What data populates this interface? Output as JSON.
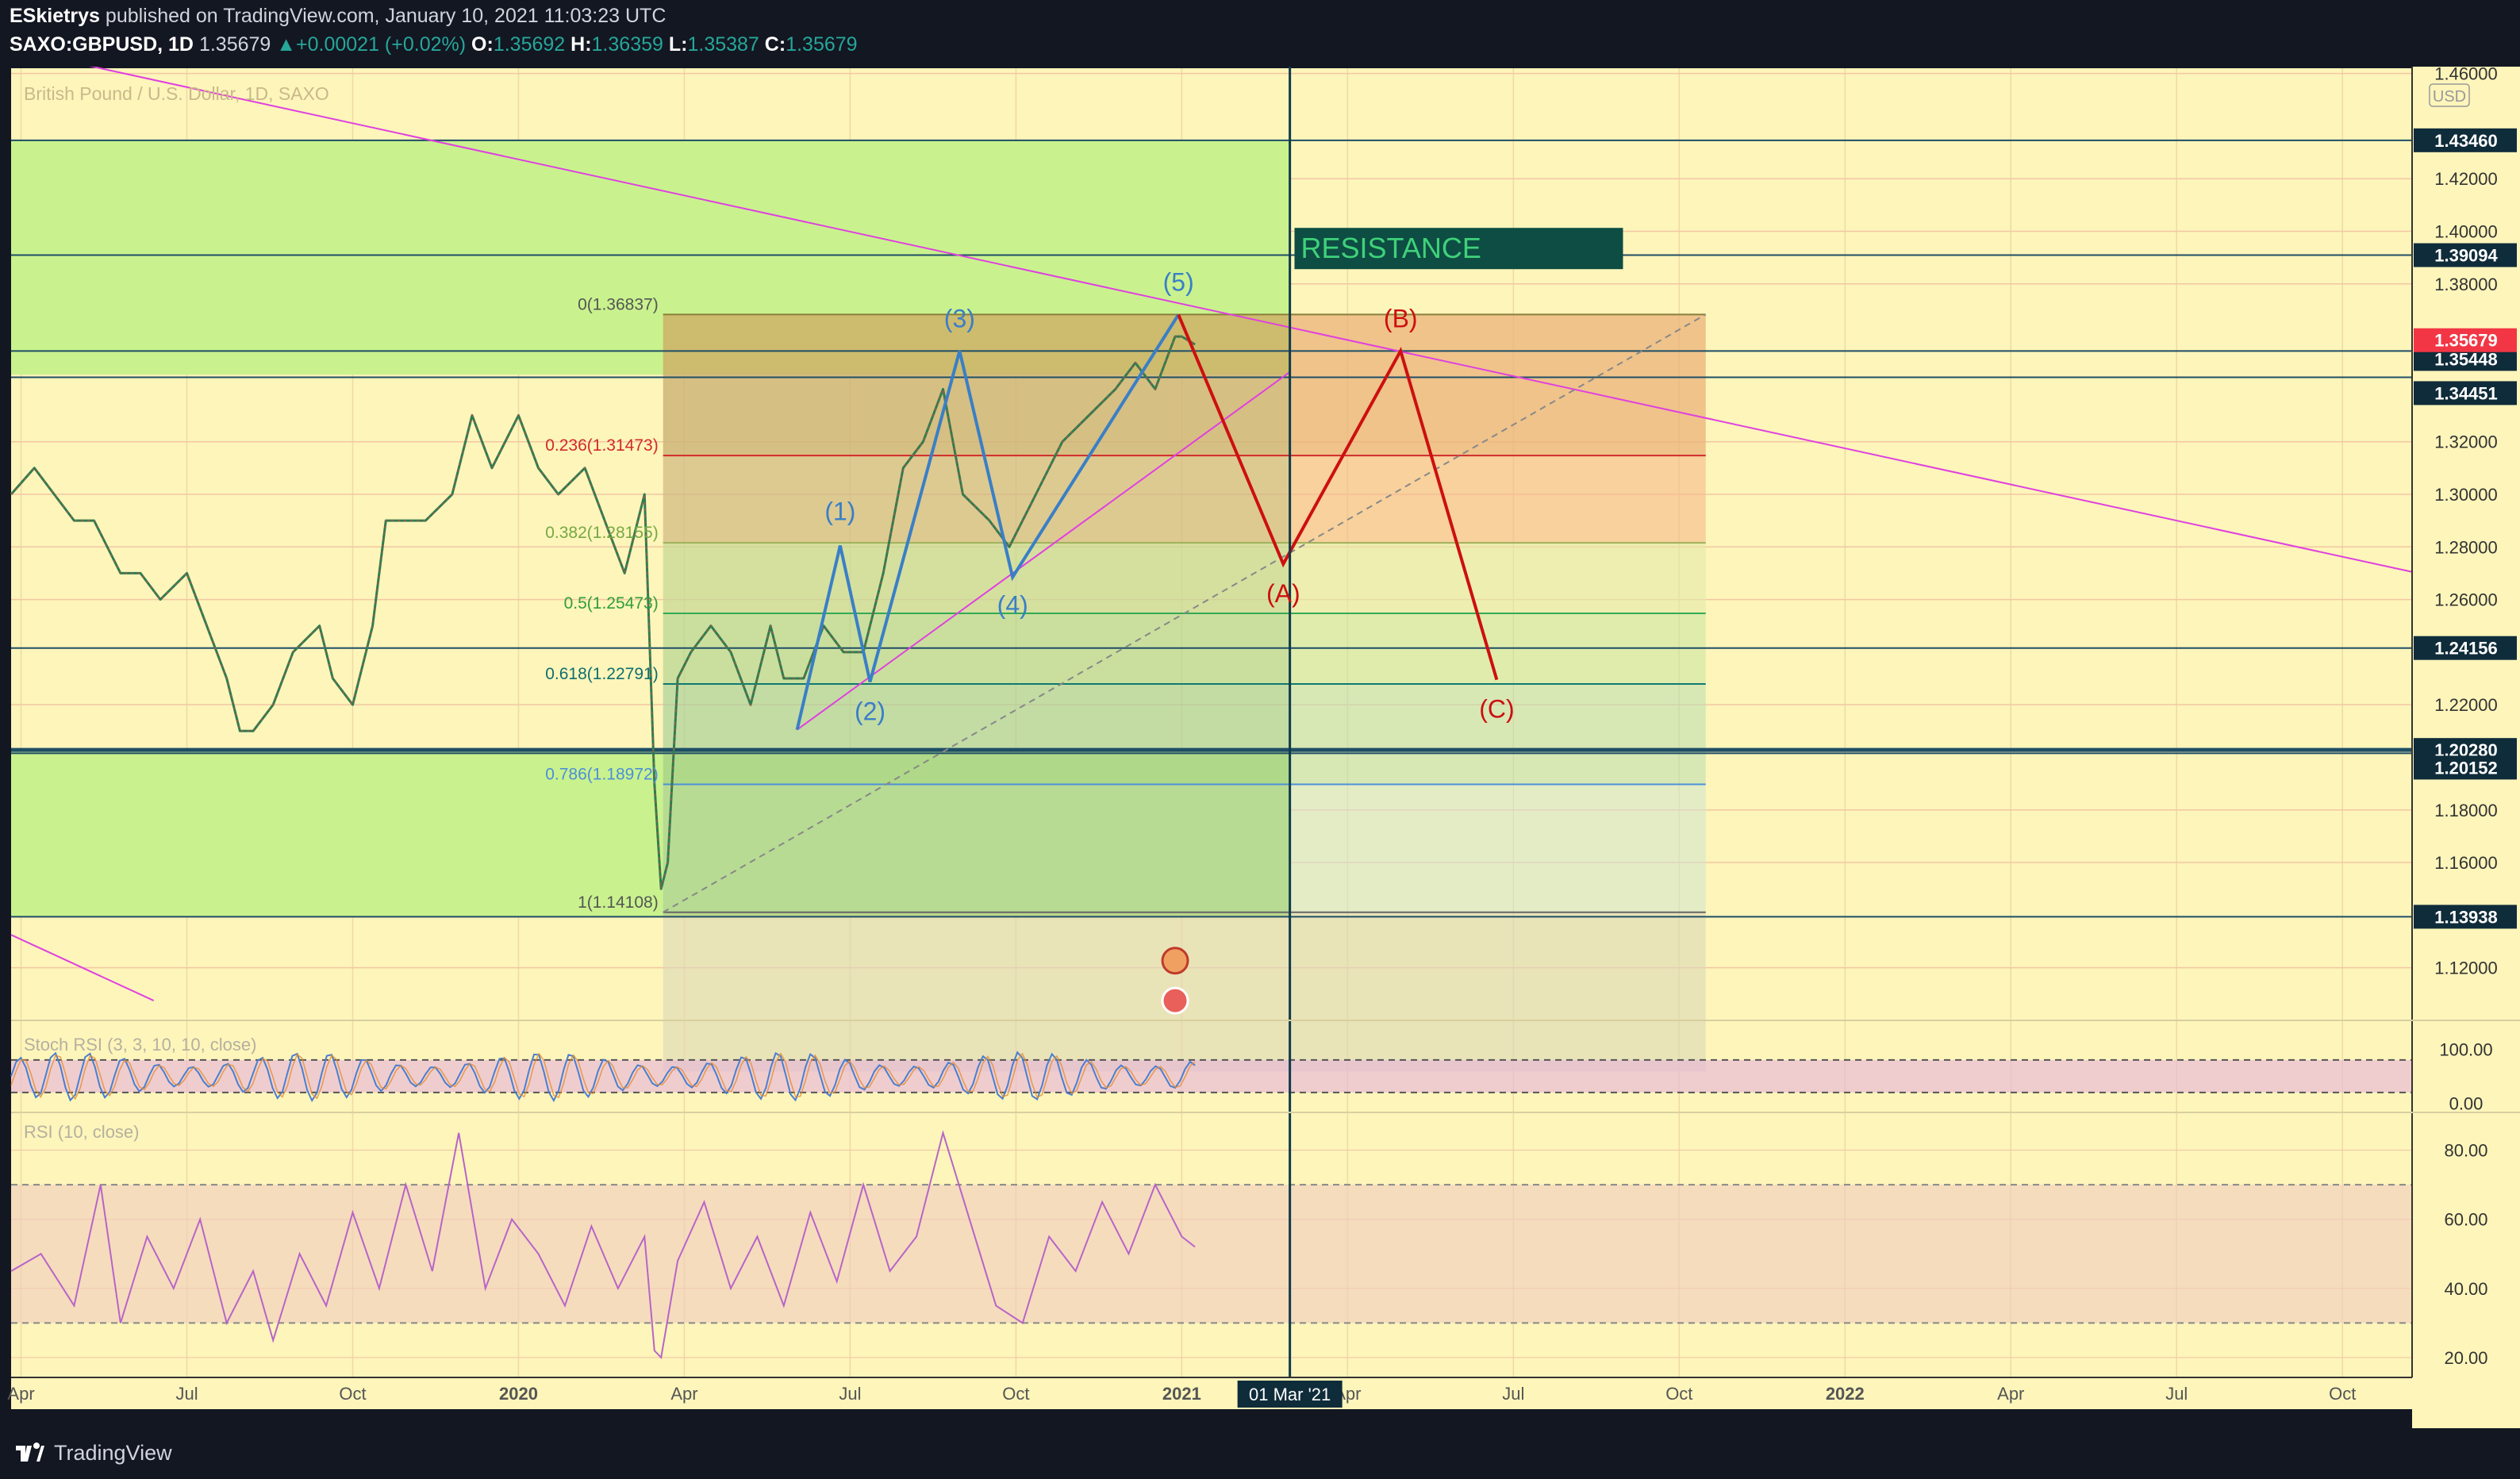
{
  "header": {
    "publisher": "ESkietrys",
    "published_text": " published on TradingView.com, January 10, 2021 11:03:23 UTC",
    "symbol": "SAXO:GBPUSD, 1D",
    "last": "1.35679",
    "change": "+0.00021 (+0.02%)",
    "o_label": "O:",
    "o": "1.35692",
    "h_label": "H:",
    "h": "1.36359",
    "l_label": "L:",
    "l": "1.35387",
    "c_label": "C:",
    "c": "1.35679"
  },
  "footer": {
    "brand": "TradingView"
  },
  "colors": {
    "background": "#fdf5ba",
    "green_zone": "#c9f28e",
    "resistance_box": "#0d4d43",
    "resistance_text": "#3fd17a",
    "wave_blue": "#3a7fc6",
    "wave_red": "#cc1010",
    "trend_magenta": "#e040e0",
    "level_line": "#1f4e66",
    "price_label_bg": "#0f2c3a",
    "current_price_bg": "#f23645"
  },
  "chart_data": [
    {
      "type": "line",
      "title": "British Pound / U.S. Dollar, 1D, SAXO",
      "currency_label": "USD",
      "x_ticks": [
        "Apr",
        "Jul",
        "Oct",
        "2020",
        "Apr",
        "Jul",
        "Oct",
        "2021",
        "Apr",
        "Jul",
        "Oct",
        "2022",
        "Apr",
        "Jul",
        "Oct"
      ],
      "x_tick_years": [
        2019.25,
        2019.5,
        2019.75,
        2020.0,
        2020.25,
        2020.5,
        2020.75,
        2021.0,
        2021.25,
        2021.5,
        2021.75,
        2022.0,
        2022.25,
        2022.5,
        2022.75
      ],
      "xlim": [
        2019.235,
        2022.855
      ],
      "ylim": [
        1.103,
        1.462
      ],
      "y_ticks": [
        1.46,
        1.42,
        1.4,
        1.38,
        1.32,
        1.3,
        1.28,
        1.26,
        1.22,
        1.18,
        1.16,
        1.12
      ],
      "y_tick_labels": [
        "1.46000",
        "1.42000",
        "1.40000",
        "1.38000",
        "1.32000",
        "1.30000",
        "1.28000",
        "1.26000",
        "1.22000",
        "1.18000",
        "1.16000",
        "1.12000"
      ],
      "price_series": {
        "x": [
          2019.235,
          2019.27,
          2019.3,
          2019.33,
          2019.36,
          2019.4,
          2019.43,
          2019.46,
          2019.5,
          2019.53,
          2019.56,
          2019.58,
          2019.6,
          2019.63,
          2019.66,
          2019.7,
          2019.72,
          2019.75,
          2019.78,
          2019.8,
          2019.83,
          2019.86,
          2019.9,
          2019.93,
          2019.96,
          2020.0,
          2020.03,
          2020.06,
          2020.1,
          2020.13,
          2020.16,
          2020.19,
          2020.205,
          2020.215,
          2020.225,
          2020.24,
          2020.26,
          2020.29,
          2020.32,
          2020.35,
          2020.38,
          2020.4,
          2020.43,
          2020.46,
          2020.49,
          2020.52,
          2020.55,
          2020.58,
          2020.61,
          2020.64,
          2020.67,
          2020.71,
          2020.74,
          2020.78,
          2020.82,
          2020.86,
          2020.9,
          2020.93,
          2020.96,
          2020.99,
          2021.0,
          2021.02
        ],
        "y": [
          1.3,
          1.31,
          1.3,
          1.29,
          1.29,
          1.27,
          1.27,
          1.26,
          1.27,
          1.25,
          1.23,
          1.21,
          1.21,
          1.22,
          1.24,
          1.25,
          1.23,
          1.22,
          1.25,
          1.29,
          1.29,
          1.29,
          1.3,
          1.33,
          1.31,
          1.33,
          1.31,
          1.3,
          1.31,
          1.29,
          1.27,
          1.3,
          1.19,
          1.15,
          1.16,
          1.23,
          1.24,
          1.25,
          1.24,
          1.22,
          1.25,
          1.23,
          1.23,
          1.25,
          1.24,
          1.24,
          1.27,
          1.31,
          1.32,
          1.34,
          1.3,
          1.29,
          1.28,
          1.3,
          1.32,
          1.33,
          1.34,
          1.35,
          1.34,
          1.36,
          1.36,
          1.357
        ]
      },
      "drawings": {
        "fib_levels": [
          {
            "label": "0(1.36837)",
            "value": 1.36837
          },
          {
            "label": "0.236(1.31473)",
            "value": 1.31473
          },
          {
            "label": "0.382(1.28155)",
            "value": 1.28155
          },
          {
            "label": "0.5(1.25473)",
            "value": 1.25473
          },
          {
            "label": "0.618(1.22791)",
            "value": 1.22791
          },
          {
            "label": "0.786(1.18972)",
            "value": 1.18972
          },
          {
            "label": "1(1.14108)",
            "value": 1.14108
          }
        ],
        "horizontal_levels": [
          {
            "label": "1.43460",
            "value": 1.4346
          },
          {
            "label": "1.39094",
            "value": 1.39094
          },
          {
            "label": "1.35448",
            "value": 1.35448
          },
          {
            "label": "1.34451",
            "value": 1.34451
          },
          {
            "label": "1.24156",
            "value": 1.24156
          },
          {
            "label": "1.20280",
            "value": 1.2028
          },
          {
            "label": "1.20152",
            "value": 1.20152
          },
          {
            "label": "1.13938",
            "value": 1.13938
          }
        ],
        "current_price": {
          "label": "1.35679",
          "value": 1.35679
        },
        "resistance_label": "RESISTANCE",
        "impulse_waves": [
          {
            "label": "(1)",
            "x": 2020.485,
            "y": 1.2805
          },
          {
            "label": "(2)",
            "x": 2020.53,
            "y": 1.2287
          },
          {
            "label": "(3)",
            "x": 2020.665,
            "y": 1.3545
          },
          {
            "label": "(4)",
            "x": 2020.745,
            "y": 1.2685
          },
          {
            "label": "(5)",
            "x": 2020.995,
            "y": 1.3683
          }
        ],
        "impulse_start": {
          "x": 2020.42,
          "y": 1.2105
        },
        "corrective_waves": [
          {
            "label": "(A)",
            "x": 2021.153,
            "y": 1.2735
          },
          {
            "label": "(B)",
            "x": 2021.33,
            "y": 1.3545
          },
          {
            "label": "(C)",
            "x": 2021.475,
            "y": 1.2295
          }
        ],
        "vertical_marker_label": "01 Mar '21",
        "vertical_marker_x": 2021.163
      }
    },
    {
      "type": "line",
      "title": "Stoch RSI (3, 3, 10, 10, close)",
      "ylim": [
        -5,
        115
      ],
      "y_ticks": [
        100,
        0
      ],
      "y_tick_labels": [
        "100.00",
        "0.00"
      ],
      "levels": [
        80,
        20
      ]
    },
    {
      "type": "line",
      "title": "RSI (10, close)",
      "ylim": [
        17,
        90
      ],
      "y_ticks": [
        80,
        60,
        40,
        20
      ],
      "y_tick_labels": [
        "80.00",
        "60.00",
        "40.00",
        "20.00"
      ],
      "levels": [
        70,
        30
      ],
      "series_x": [
        2019.235,
        2019.28,
        2019.33,
        2019.37,
        2019.4,
        2019.44,
        2019.48,
        2019.52,
        2019.56,
        2019.6,
        2019.63,
        2019.67,
        2019.71,
        2019.75,
        2019.79,
        2019.83,
        2019.87,
        2019.91,
        2019.95,
        2019.99,
        2020.03,
        2020.07,
        2020.11,
        2020.15,
        2020.19,
        2020.205,
        2020.215,
        2020.24,
        2020.28,
        2020.32,
        2020.36,
        2020.4,
        2020.44,
        2020.48,
        2020.52,
        2020.56,
        2020.6,
        2020.64,
        2020.68,
        2020.72,
        2020.76,
        2020.8,
        2020.84,
        2020.88,
        2020.92,
        2020.96,
        2021.0,
        2021.02
      ],
      "series_y": [
        45,
        50,
        35,
        70,
        30,
        55,
        40,
        60,
        30,
        45,
        25,
        50,
        35,
        62,
        40,
        70,
        45,
        85,
        40,
        60,
        50,
        35,
        58,
        40,
        55,
        22,
        20,
        48,
        65,
        40,
        55,
        35,
        62,
        42,
        70,
        45,
        55,
        85,
        60,
        35,
        30,
        55,
        45,
        65,
        50,
        70,
        55,
        52
      ]
    }
  ]
}
